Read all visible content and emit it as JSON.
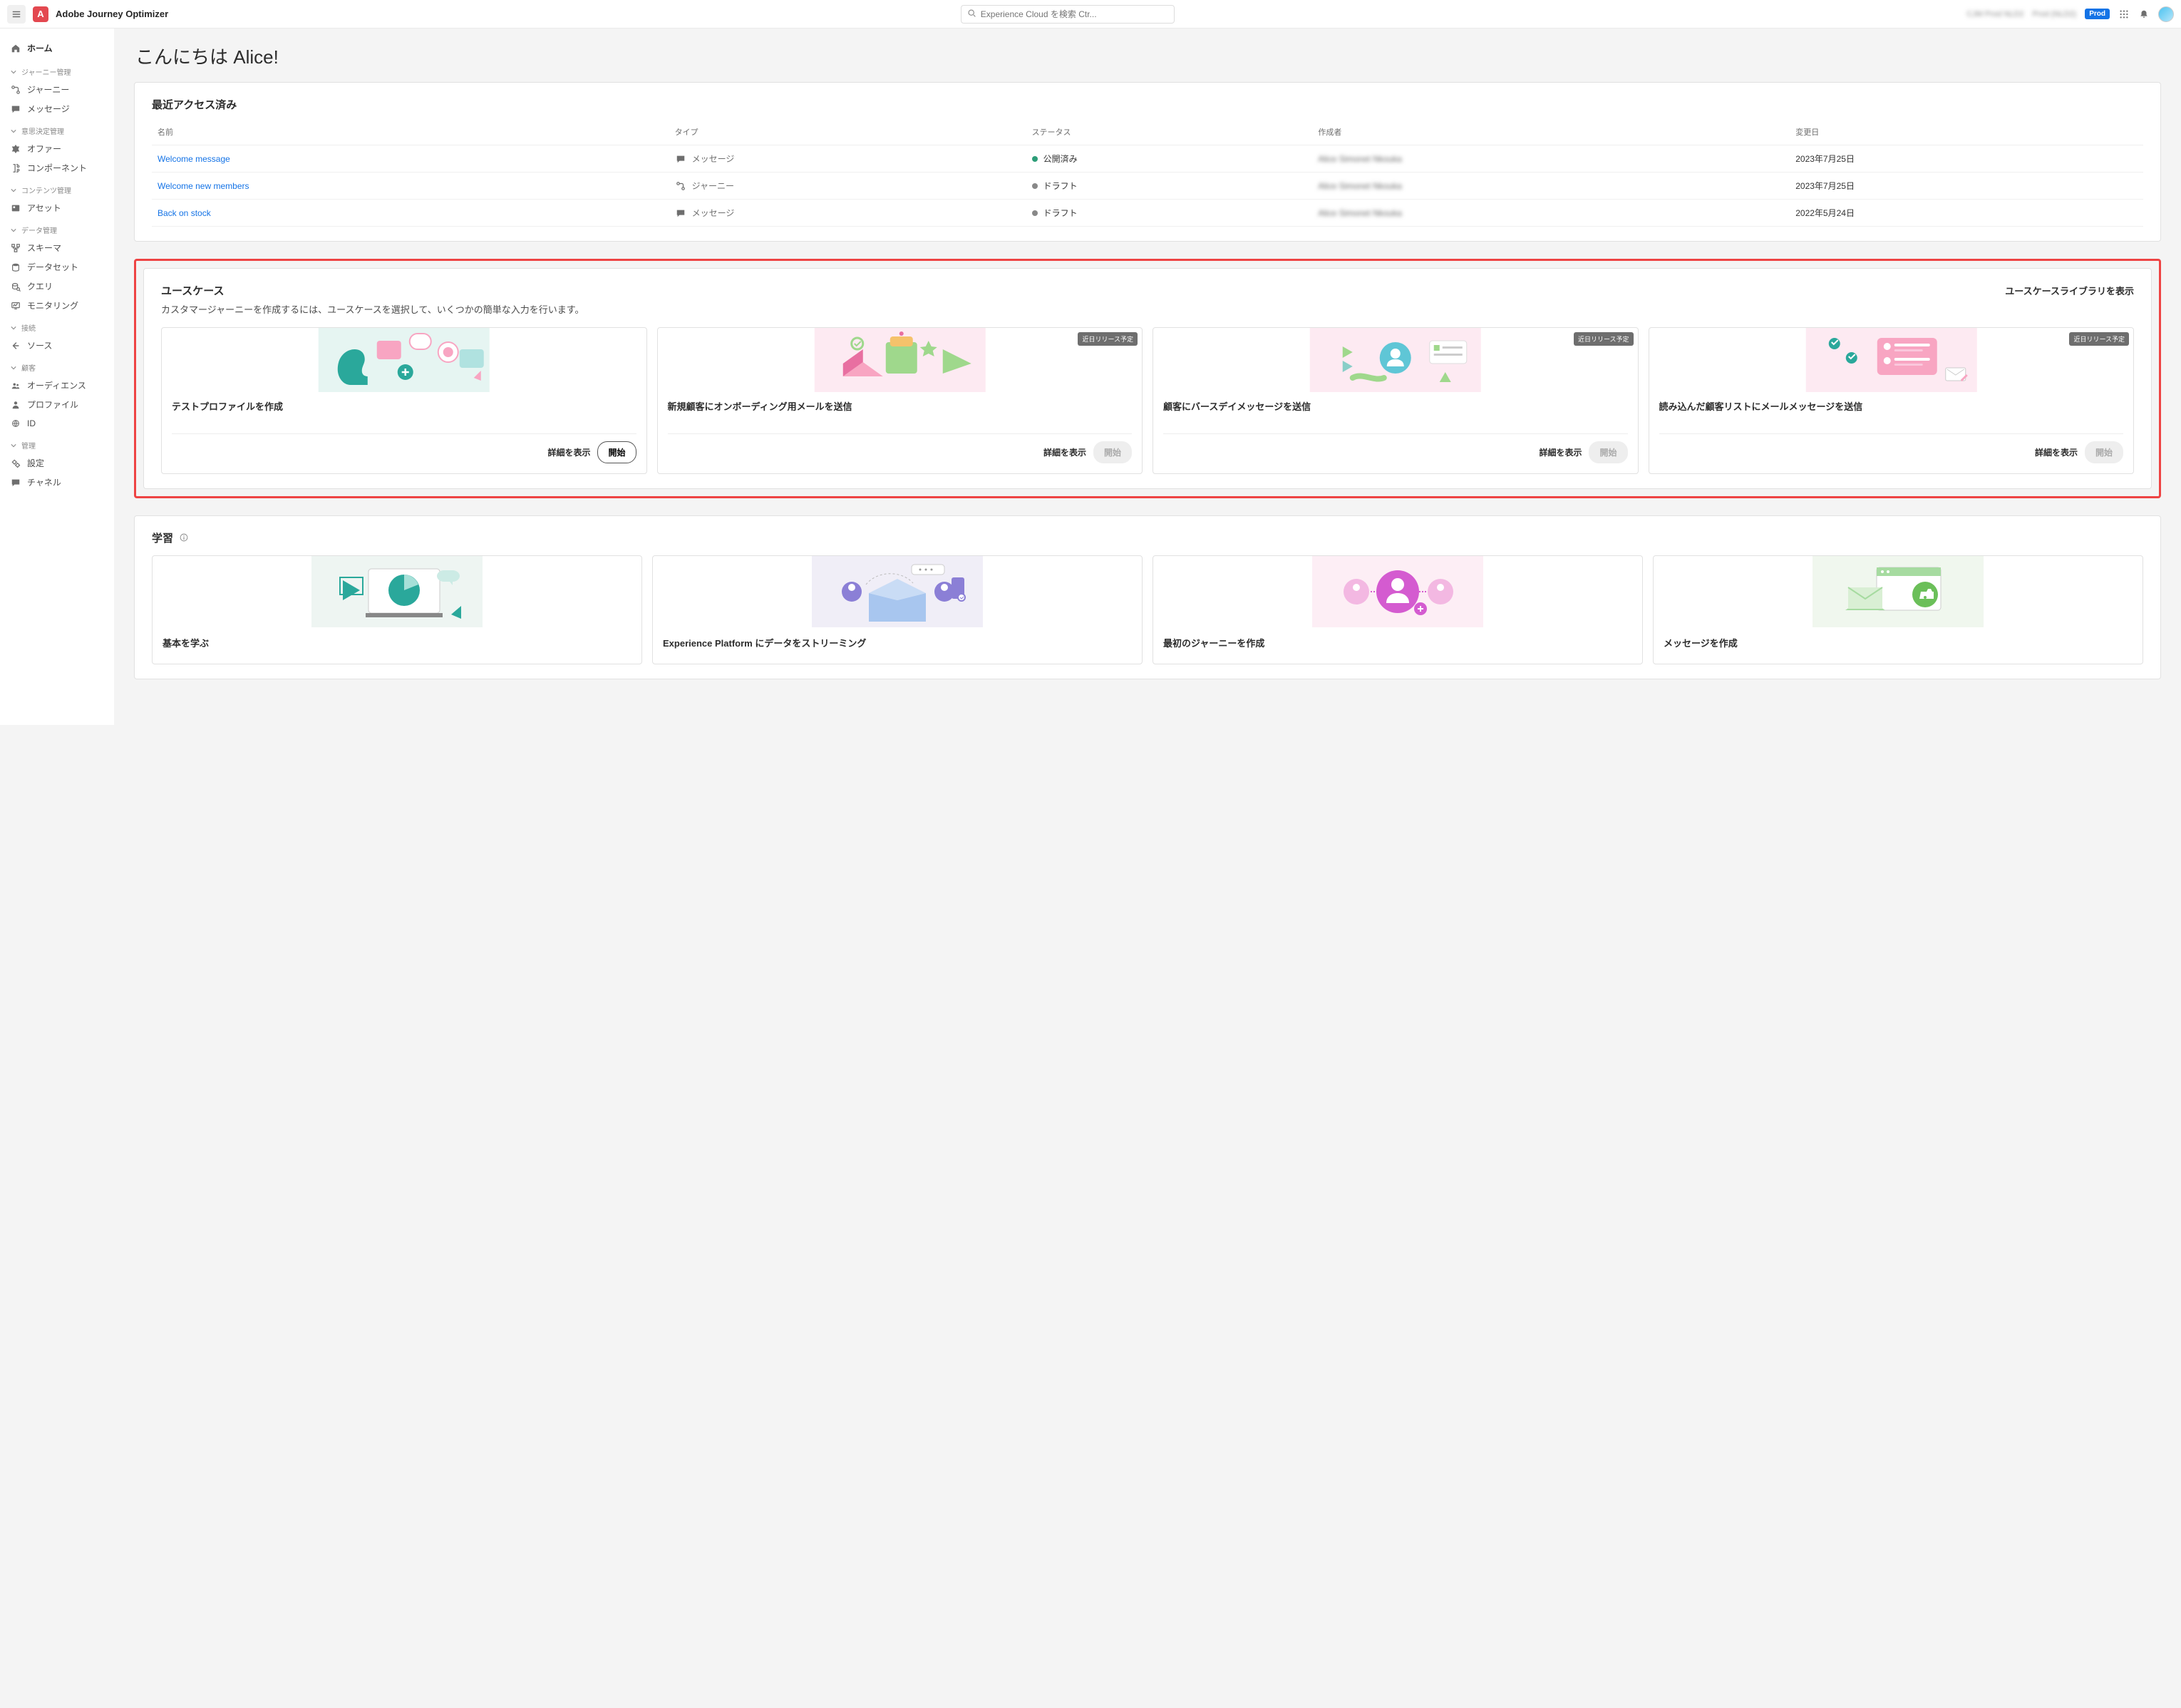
{
  "header": {
    "app_name": "Adobe Journey Optimizer",
    "search_placeholder": "Experience Cloud を検索 Ctr...",
    "org_label_1": "CJM Prod NLD2",
    "org_label_2": "Prod (NLD2)",
    "env_badge": "Prod"
  },
  "sidebar": {
    "home": "ホーム",
    "groups": [
      {
        "label": "ジャーニー管理",
        "items": [
          {
            "icon": "journey",
            "label": "ジャーニー"
          },
          {
            "icon": "message",
            "label": "メッセージ"
          }
        ]
      },
      {
        "label": "意思決定管理",
        "items": [
          {
            "icon": "offer",
            "label": "オファー"
          },
          {
            "icon": "component",
            "label": "コンポーネント"
          }
        ]
      },
      {
        "label": "コンテンツ管理",
        "items": [
          {
            "icon": "asset",
            "label": "アセット"
          }
        ]
      },
      {
        "label": "データ管理",
        "items": [
          {
            "icon": "schema",
            "label": "スキーマ"
          },
          {
            "icon": "dataset",
            "label": "データセット"
          },
          {
            "icon": "query",
            "label": "クエリ"
          },
          {
            "icon": "monitor",
            "label": "モニタリング"
          }
        ]
      },
      {
        "label": "接続",
        "items": [
          {
            "icon": "source",
            "label": "ソース"
          }
        ]
      },
      {
        "label": "顧客",
        "items": [
          {
            "icon": "audience",
            "label": "オーディエンス"
          },
          {
            "icon": "profile",
            "label": "プロファイル"
          },
          {
            "icon": "id",
            "label": "ID"
          }
        ]
      },
      {
        "label": "管理",
        "items": [
          {
            "icon": "settings",
            "label": "設定"
          },
          {
            "icon": "channel",
            "label": "チャネル"
          }
        ]
      }
    ]
  },
  "greeting": "こんにちは Alice!",
  "recent": {
    "title": "最近アクセス済み",
    "columns": {
      "name": "名前",
      "type": "タイプ",
      "status": "ステータス",
      "creator": "作成者",
      "modified": "変更日"
    },
    "type_labels": {
      "message": "メッセージ",
      "journey": "ジャーニー"
    },
    "status_labels": {
      "published": "公開済み",
      "draft": "ドラフト"
    },
    "rows": [
      {
        "name": "Welcome message",
        "type": "message",
        "status": "published",
        "creator": "Alice Simonet Nkouka",
        "modified": "2023年7月25日"
      },
      {
        "name": "Welcome new members",
        "type": "journey",
        "status": "draft",
        "creator": "Alice Simonet Nkouka",
        "modified": "2023年7月25日"
      },
      {
        "name": "Back on stock",
        "type": "message",
        "status": "draft",
        "creator": "Alice Simonet Nkouka",
        "modified": "2022年5月24日"
      }
    ]
  },
  "usecases": {
    "title": "ユースケース",
    "subtitle": "カスタマージャーニーを作成するには、ユースケースを選択して、いくつかの簡単な入力を行います。",
    "library_link": "ユースケースライブラリを表示",
    "coming_soon": "近日リリース予定",
    "detail_label": "詳細を表示",
    "start_label": "開始",
    "cards": [
      {
        "title": "テストプロファイルを作成",
        "coming": false
      },
      {
        "title": "新規顧客にオンボーディング用メールを送信",
        "coming": true
      },
      {
        "title": "顧客にバースデイメッセージを送信",
        "coming": true
      },
      {
        "title": "読み込んだ顧客リストにメールメッセージを送信",
        "coming": true
      }
    ]
  },
  "learning": {
    "title": "学習",
    "cards": [
      {
        "title": "基本を学ぶ"
      },
      {
        "title": "Experience Platform にデータをストリーミング"
      },
      {
        "title": "最初のジャーニーを作成"
      },
      {
        "title": "メッセージを作成"
      }
    ]
  }
}
